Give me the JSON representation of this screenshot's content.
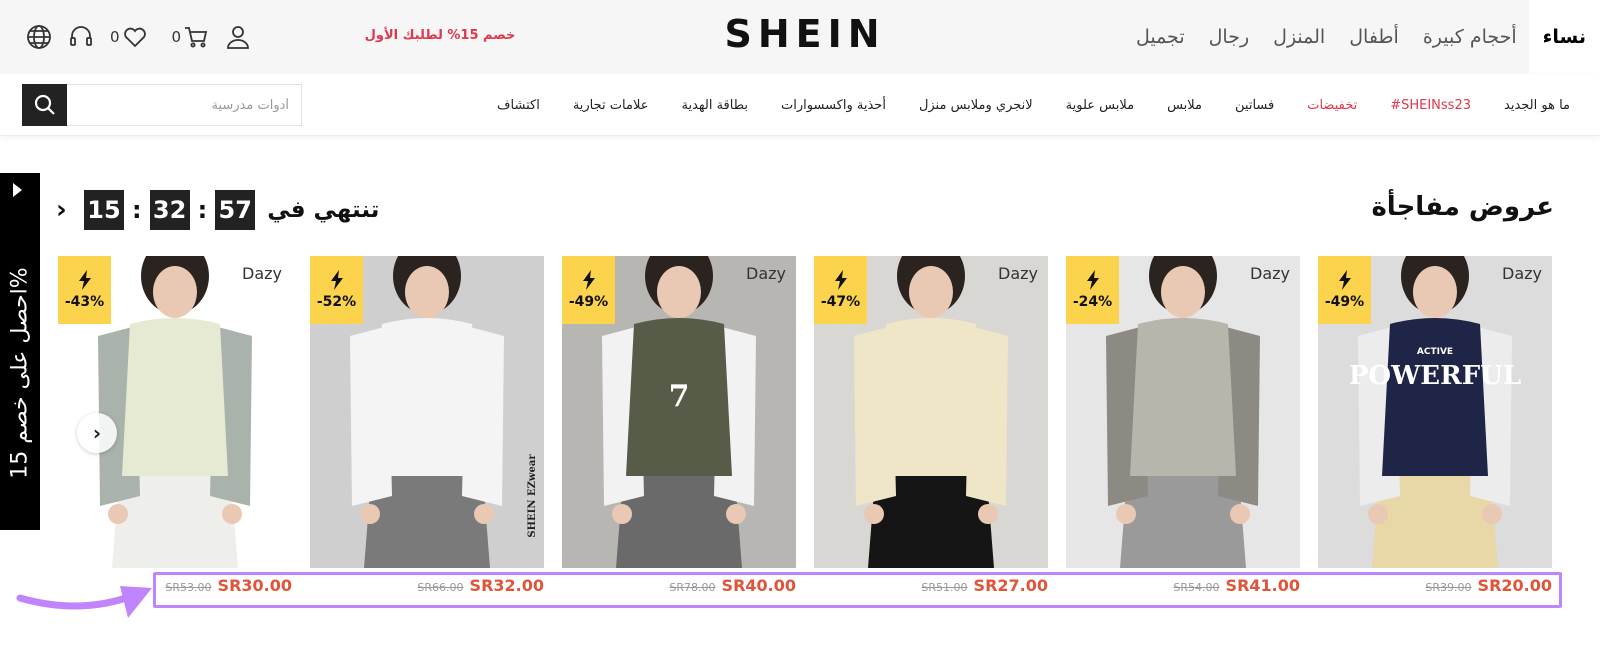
{
  "header": {
    "top_tabs": [
      "نساء",
      "أحجام كبيرة",
      "أطفال",
      "المنزل",
      "رجال",
      "تجميل"
    ],
    "logo": "SHEIN",
    "promo": "خصم 15% لطلبك الأول",
    "cart_count": "0",
    "wishlist_count": "0",
    "icons": [
      "user-icon",
      "cart-icon",
      "heart-icon",
      "headset-icon",
      "globe-icon"
    ]
  },
  "nav": {
    "categories": [
      "ما هو الجديد",
      "#SHEINss23",
      "تخفيضات",
      "فساتين",
      "ملابس",
      "ملابس علوية",
      "لانجري وملابس منزل",
      "أحذية واكسسوارات",
      "بطاقة الهدية",
      "علامات تجارية",
      "اكتشاف"
    ],
    "highlight_color": "#e0374b"
  },
  "search": {
    "placeholder": "أدوات مدرسية"
  },
  "side_tab": {
    "label": "احصل على خصم 15%"
  },
  "flash_sale": {
    "title": "عروض مفاجأة",
    "ends_label": "تنتهي في",
    "countdown": {
      "hours": "15",
      "minutes": "32",
      "seconds": "57"
    }
  },
  "products": [
    {
      "brand": "Dazy",
      "discount": "-49%",
      "old_price": "SR39.00",
      "price": "SR20.00"
    },
    {
      "brand": "Dazy",
      "discount": "-24%",
      "old_price": "SR54.00",
      "price": "SR41.00"
    },
    {
      "brand": "Dazy",
      "discount": "-47%",
      "old_price": "SR51.00",
      "price": "SR27.00"
    },
    {
      "brand": "Dazy",
      "discount": "-49%",
      "old_price": "SR78.00",
      "price": "SR40.00"
    },
    {
      "brand": "",
      "discount": "-52%",
      "old_price": "SR66.00",
      "price": "SR32.00"
    },
    {
      "brand": "Dazy",
      "discount": "-43%",
      "old_price": "SR53.00",
      "price": "SR30.00"
    }
  ],
  "product_images": [
    {
      "bg": "#dcdcdc",
      "top": "#1f2547",
      "sleeve": "#ececec",
      "bottom": "#e8d8a8",
      "text": "POWERFUL",
      "subtext": "ACTIVE"
    },
    {
      "bg": "#e6e6e6",
      "top": "#b8b5ad",
      "sleeve": "#8d8a84",
      "bottom": "#9a9a9a",
      "text": "",
      "subtext": ""
    },
    {
      "bg": "#d9d7d3",
      "top": "#efe6c8",
      "sleeve": "#efe6c8",
      "bottom": "#151515",
      "text": "",
      "subtext": ""
    },
    {
      "bg": "#b8b6b2",
      "top": "#575c49",
      "sleeve": "#f2f2f2",
      "bottom": "#6a6a6a",
      "text": "7",
      "subtext": ""
    },
    {
      "bg": "#cfcfcf",
      "top": "#f4f4f4",
      "sleeve": "#f4f4f4",
      "bottom": "#7a7a7a",
      "text": "SHEIN EZwear",
      "subtext": ""
    },
    {
      "bg": "#ffffff",
      "top": "#e7ead2",
      "sleeve": "#a9b3ac",
      "bottom": "#eeeeea",
      "text": "",
      "subtext": ""
    }
  ],
  "colors": {
    "accent": "#e0374b",
    "price": "#e0543a",
    "badge": "#fcd34d",
    "annotation": "#c084fc"
  }
}
